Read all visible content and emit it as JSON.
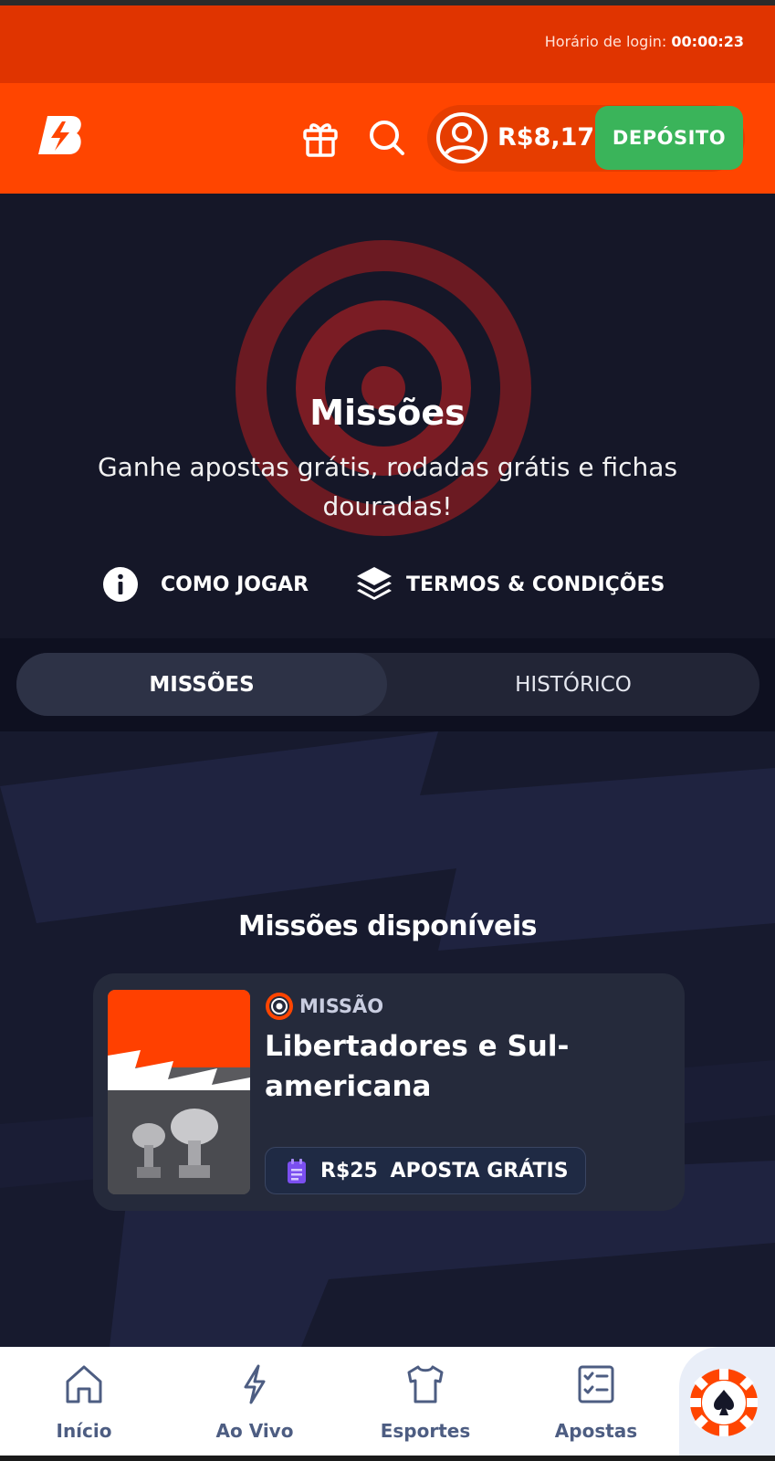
{
  "login": {
    "label": "Horário de login:",
    "time": "00:00:23"
  },
  "header": {
    "logo_icon": "brand-logo",
    "gift_icon": "gift-icon",
    "search_icon": "search-icon",
    "user_icon": "user-icon",
    "balance": "R$8,17",
    "deposit_label": "DEPÓSITO",
    "accent": "#ff4500",
    "deposit_color": "#3ab45a"
  },
  "hero": {
    "title": "Missões",
    "subtitle": "Ganhe apostas grátis, rodadas grátis e fichas douradas!",
    "how_to_play": "COMO JOGAR",
    "terms": "TERMOS & CONDIÇÕES"
  },
  "tabs": [
    {
      "label": "MISSÕES",
      "active": true
    },
    {
      "label": "HISTÓRICO",
      "active": false
    }
  ],
  "section": {
    "title": "Missões disponíveis"
  },
  "missions": [
    {
      "tag": "MISSÃO",
      "title": "Libertadores e Sul-americana",
      "reward": "R$25",
      "reward_type": "APOSTA GRÁTIS",
      "image_icon": "trophy-image"
    }
  ],
  "nav": [
    {
      "label": "Início",
      "icon": "home-icon"
    },
    {
      "label": "Ao Vivo",
      "icon": "lightning-icon"
    },
    {
      "label": "Esportes",
      "icon": "shirt-icon"
    },
    {
      "label": "Apostas",
      "icon": "checklist-icon"
    },
    {
      "label": "",
      "icon": "casino-chip-icon"
    }
  ]
}
